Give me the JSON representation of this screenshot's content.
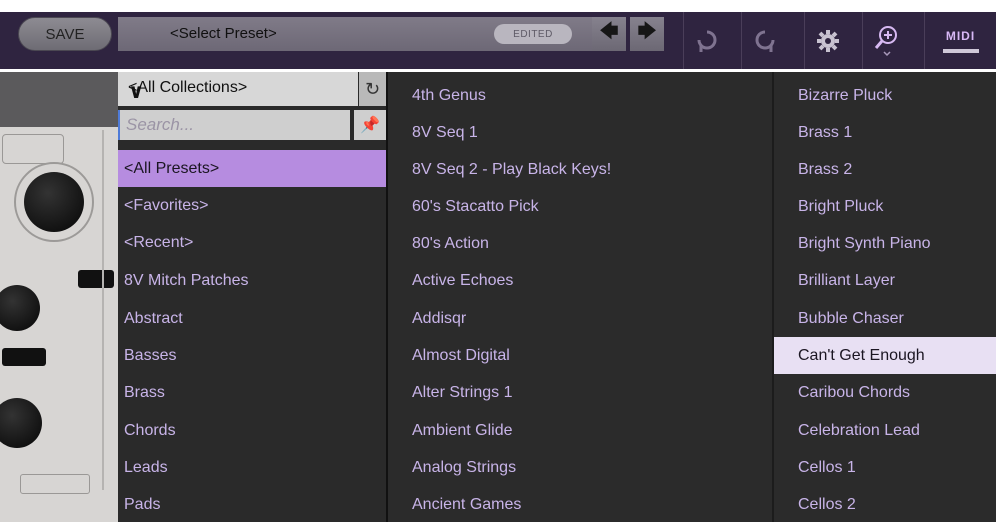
{
  "toolbar": {
    "save_label": "SAVE",
    "preset_name": "<Select Preset>",
    "edited_label": "EDITED",
    "midi_label": "MIDI",
    "icons": [
      "arrow-left-icon",
      "arrow-right-icon",
      "undo-icon",
      "redo-icon",
      "gear-icon",
      "zoom-icon",
      "midi-icon"
    ]
  },
  "collections": {
    "selected_collection": "<All Collections>",
    "search_placeholder": "Search...",
    "items": [
      "<All Presets>",
      "<Favorites>",
      "<Recent>",
      "8V Mitch Patches",
      "Abstract",
      "Basses",
      "Brass",
      "Chords",
      "Leads",
      "Pads"
    ],
    "selected_index": 0
  },
  "presets": {
    "column1": [
      "4th Genus",
      "8V Seq 1",
      "8V Seq 2 - Play Black Keys!",
      "60's Stacatto Pick",
      "80's Action",
      "Active Echoes",
      "Addisqr",
      "Almost Digital",
      "Alter Strings 1",
      "Ambient Glide",
      "Analog Strings",
      "Ancient Games"
    ],
    "column2": [
      "Bizarre Pluck",
      "Brass 1",
      "Brass 2",
      "Bright Pluck",
      "Bright Synth Piano",
      "Brilliant Layer",
      "Bubble Chaser",
      "Can't Get Enough",
      "Caribou Chords",
      "Celebration Lead",
      "Cellos 1",
      "Cellos 2"
    ],
    "selected_column2_index": 7
  },
  "colors": {
    "accent": "#b68ce0",
    "item_text": "#c8b4e8",
    "toolbar_bg": "#2f2440"
  }
}
